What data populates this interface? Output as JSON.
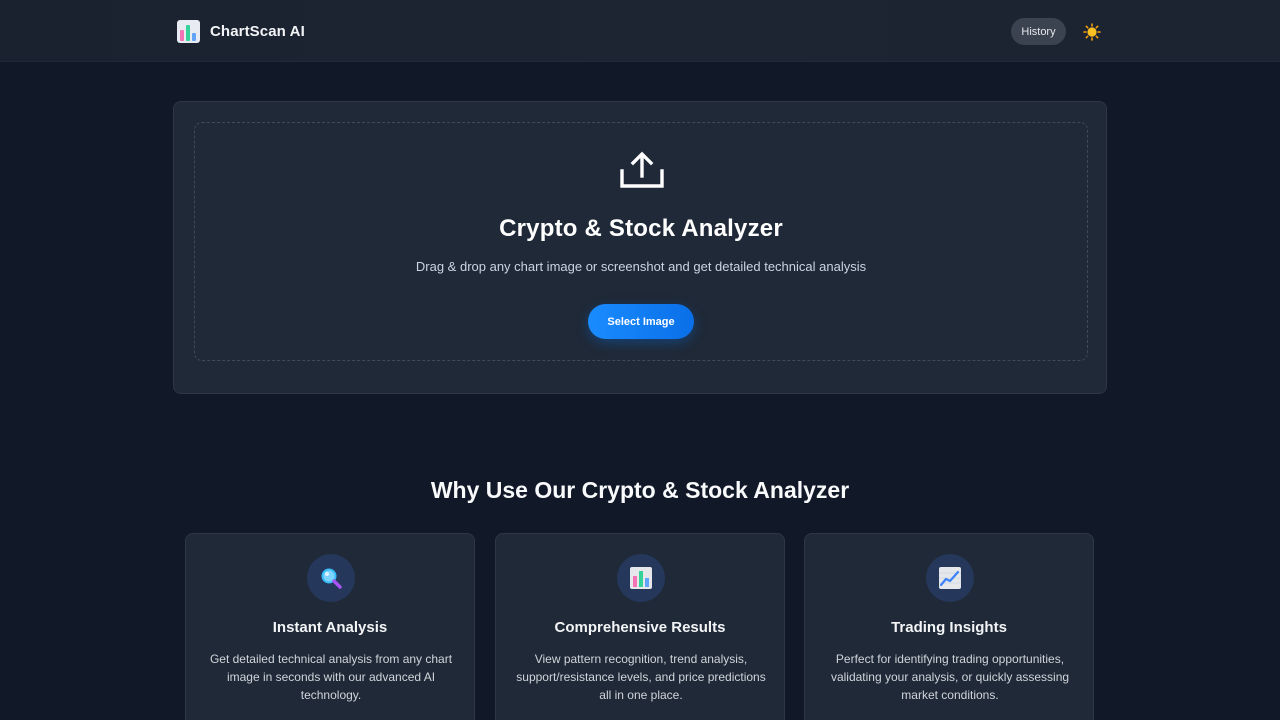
{
  "header": {
    "brand_name": "ChartScan AI",
    "history_label": "History",
    "logo_icon": "bar-chart-icon",
    "theme_icon": "sun-icon"
  },
  "upload": {
    "icon": "upload-icon",
    "title": "Crypto & Stock Analyzer",
    "subtitle": "Drag & drop any chart image or screenshot and get detailed technical analysis",
    "button_label": "Select Image"
  },
  "features": {
    "title": "Why Use Our Crypto & Stock Analyzer",
    "items": [
      {
        "icon": "magnifier-icon",
        "title": "Instant Analysis",
        "description": "Get detailed technical analysis from any chart image in seconds with our advanced AI technology."
      },
      {
        "icon": "bar-chart-icon",
        "title": "Comprehensive Results",
        "description": "View pattern recognition, trend analysis, support/resistance levels, and price predictions all in one place."
      },
      {
        "icon": "trending-up-icon",
        "title": "Trading Insights",
        "description": "Perfect for identifying trading opportunities, validating your analysis, or quickly assessing market conditions."
      }
    ]
  },
  "colors": {
    "background": "#111827",
    "card": "#1f2937",
    "accent": "#0a6fe8"
  }
}
